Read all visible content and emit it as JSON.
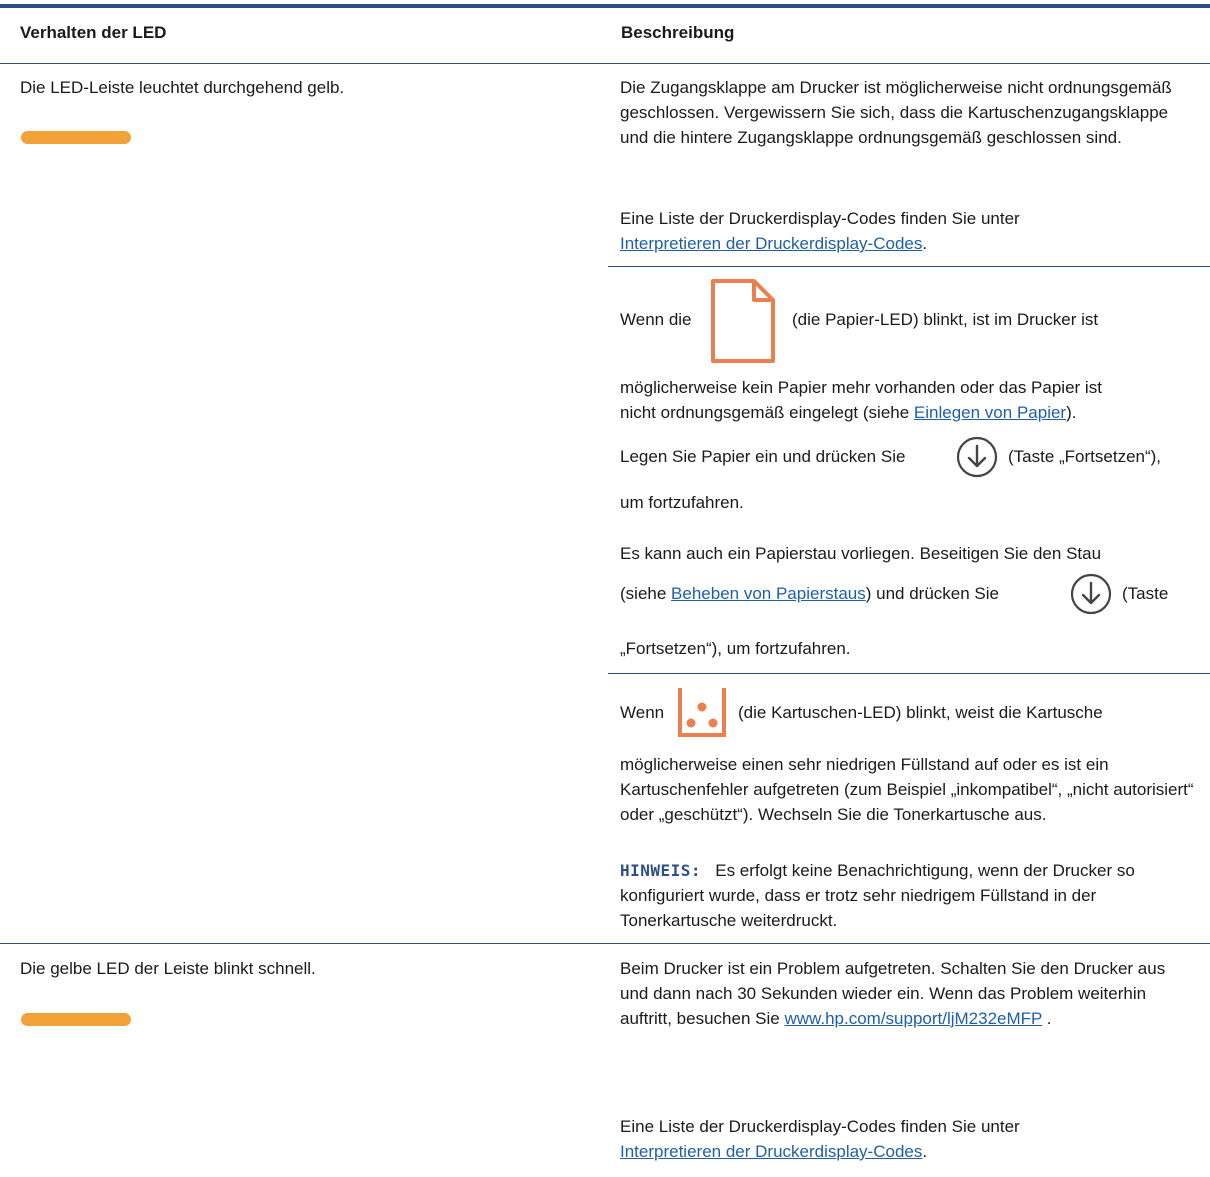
{
  "table": {
    "headers": {
      "behavior": "Verhalten der LED",
      "description": "Beschreibung"
    },
    "rows": [
      {
        "behavior": "Die LED-Leiste leuchtet durchgehend gelb.",
        "entries": {
          "door": {
            "text": "Die Zugangsklappe am Drucker ist möglicherweise nicht ordnungsgemäß geschlossen. Vergewissern Sie sich, dass die Kartuschenzugangsklappe und die hintere Zugangsklappe ordnungsgemäß geschlossen sind.",
            "list_text": "Eine Liste der Druckerdisplay-Codes finden Sie unter",
            "list_link": "Interpretieren der Druckerdisplay-Codes",
            "list_end": "."
          },
          "paper": {
            "wenn": "Wenn die",
            "after_icon": "(die Papier-LED) blinkt, ist im Drucker ist",
            "line2": "möglicherweise kein Papier mehr vorhanden oder das Papier ist",
            "line3_pre": "nicht ordnungsgemäß eingelegt (siehe",
            "line3_link": "Einlegen von Papier",
            "line3_post": ").",
            "load_pre": "Legen Sie Papier ein und drücken Sie",
            "load_post": "(Taste „Fortsetzen“),",
            "continue": "um fortzufahren.",
            "jam_line": "Es kann auch ein Papierstau vorliegen. Beseitigen Sie den Stau",
            "jam_pre": "(siehe",
            "jam_link": "Beheben von Papierstaus",
            "jam_mid": ") und drücken Sie",
            "jam_post": "(Taste",
            "jam_end": "„Fortsetzen“), um fortzufahren."
          },
          "cartridge": {
            "wenn": "Wenn",
            "after_icon": "(die Kartuschen-LED) blinkt, weist die Kartusche",
            "text": "möglicherweise einen sehr niedrigen Füllstand auf oder es ist ein Kartuschenfehler aufgetreten (zum Beispiel „inkompatibel“, „nicht autorisiert“ oder „geschützt“). Wechseln Sie die Tonerkartusche aus.",
            "note_label": "HINWEIS:",
            "note_text": "Es erfolgt keine Benachrichtigung, wenn der Drucker so konfiguriert wurde, dass er trotz sehr niedrigem Füllstand in der Tonerkartusche weiterdruckt."
          }
        }
      },
      {
        "behavior": "Die gelbe LED der Leiste blinkt schnell.",
        "entries": {
          "problem": {
            "text": "Beim Drucker ist ein Problem aufgetreten. Schalten Sie den Drucker aus und dann nach 30 Sekunden wieder ein. Wenn das Problem weiterhin auftritt, besuchen Sie",
            "link": "www.hp.com/support/ljM232eMFP",
            "end": " ."
          },
          "codes": {
            "list_text": "Eine Liste der Druckerdisplay-Codes finden Sie unter",
            "list_link": "Interpretieren der Druckerdisplay-Codes",
            "list_end": "."
          }
        }
      }
    ]
  },
  "icons": {
    "led_bar": "led-bar-icon",
    "paper": "paper-led-icon",
    "resume": "resume-button-icon",
    "cartridge": "cartridge-led-icon"
  },
  "colors": {
    "rule": "#2d4f87",
    "led_amber": "#f3a23a",
    "icon_orange": "#e8804f",
    "link": "#1f5fa8",
    "note_label": "#2d4f87"
  }
}
